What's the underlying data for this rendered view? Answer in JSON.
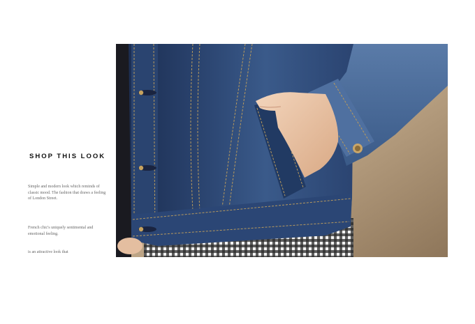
{
  "heading": "SHOP THIS LOOK",
  "paragraphs": [
    "Simple and modern look which reminds of classic mood. The fashion that draws a feeling of London Street.",
    "French chic's uniquely sentimental and emotional feeling.",
    "is an attractive look that"
  ],
  "photo": {
    "subject": "denim-jacket-hand-in-pocket",
    "colors": {
      "denim_dark": "#1e3258",
      "denim_mid": "#31507e",
      "denim_light": "#5a7ba8",
      "skin": "#e8c4a6",
      "background": "#bfa788",
      "stitching": "#b89a5e"
    }
  }
}
